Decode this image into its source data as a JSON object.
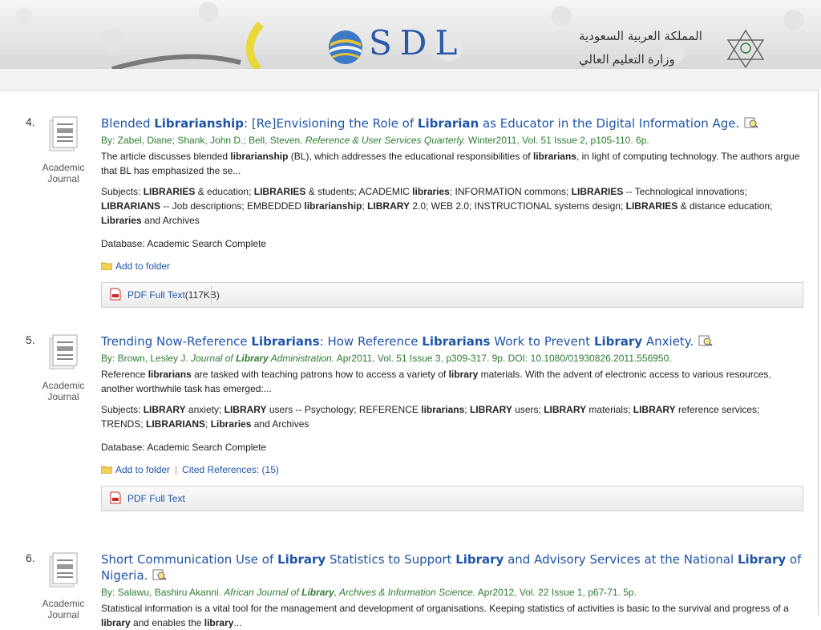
{
  "banner": {
    "logo_text": "SDL",
    "arabic_title": "المملكة العربية السعودية",
    "arabic_sub": "وزارة التعليم العالي"
  },
  "results": [
    {
      "number": "4.",
      "pub_type": "Academic Journal",
      "title_html": "Blended <b>Librarianship</b>: [Re]Envisioning the Role of <b>Librarian</b> as Educator in the Digital Information Age.",
      "byline_html": "By: Zabel, Diane; Shank, John D.; Bell, Steven. <i>Reference &amp; User Services Quarterly.</i> Winter2011, Vol. 51 Issue 2, p105-110. 6p.",
      "abstract_html": "The article discusses blended <b>librarianship</b> (BL), which addresses the educational responsibilities of <b>librarians</b>, in light of computing technology. The authors argue that BL has emphasized the se...",
      "subjects_html": "Subjects: <b>LIBRARIES</b> &amp; education; <b>LIBRARIES</b> &amp; students; ACADEMIC <b>libraries</b>; INFORMATION commons; <b>LIBRARIES</b> -- Technological innovations; <b>LIBRARIANS</b> -- Job descriptions; EMBEDDED <b>librarianship</b>; <b>LIBRARY</b> 2.0; WEB 2.0; INSTRUCTIONAL systems design; <b>LIBRARIES</b> &amp; distance education; <b>Libraries</b> and Archives",
      "database": "Database: Academic Search Complete",
      "add_to_folder": "Add to folder",
      "cited_refs": "",
      "fulltext_label": "PDF Full Text",
      "fulltext_size": "(117KB)"
    },
    {
      "number": "5.",
      "pub_type": "Academic Journal",
      "title_html": "Trending Now-Reference <b>Librarians</b>: How Reference <b>Librarians</b> Work to Prevent <b>Library</b> Anxiety.",
      "byline_html": "By: Brown, Lesley J. <i>Journal of <b>Library</b> Administration.</i> Apr2011, Vol. 51 Issue 3, p309-317. 9p. DOI: 10.1080/01930826.2011.556950.",
      "abstract_html": "Reference <b>librarians</b> are tasked with teaching patrons how to access a variety of <b>library</b> materials. With the advent of electronic access to various resources, another worthwhile task has emerged:...",
      "subjects_html": "Subjects: <b>LIBRARY</b> anxiety; <b>LIBRARY</b> users -- Psychology; REFERENCE <b>librarians</b>; <b>LIBRARY</b> users; <b>LIBRARY</b> materials; <b>LIBRARY</b> reference services; TRENDS; <b>LIBRARIANS</b>; <b>Libraries</b> and Archives",
      "database": "Database: Academic Search Complete",
      "add_to_folder": "Add to folder",
      "cited_refs": "Cited References: (15)",
      "fulltext_label": "PDF Full Text",
      "fulltext_size": ""
    },
    {
      "number": "6.",
      "pub_type": "Academic Journal",
      "title_html": "Short Communication Use of <b>Library</b> Statistics to Support <b>Library</b> and Advisory Services at the National <b>Library</b> of Nigeria.",
      "byline_html": "By: Salawu, Bashiru Akanni. <i>African Journal of <b>Library</b>, Archives &amp; Information Science.</i> Apr2012, Vol. 22 Issue 1, p67-71. 5p.",
      "abstract_html": "Statistical information is a vital tool for the management and development of organisations. Keeping statistics of activities is basic to the survival and progress of a <b>library</b> and enables the <b>library</b>...",
      "subjects_html": "",
      "database": "",
      "add_to_folder": "",
      "cited_refs": "",
      "fulltext_label": "",
      "fulltext_size": ""
    }
  ]
}
